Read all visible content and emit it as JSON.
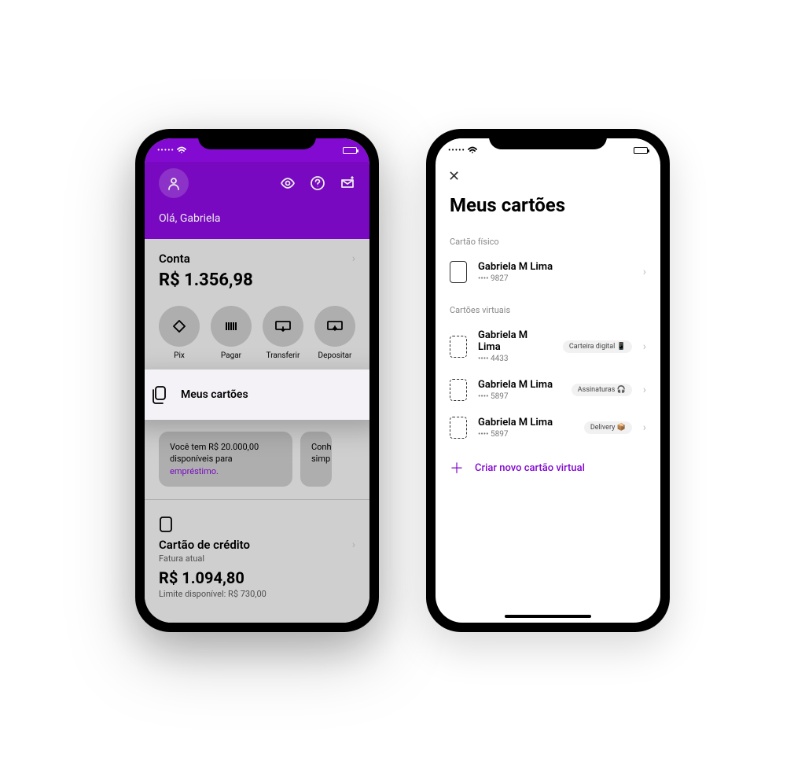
{
  "colors": {
    "brand": "#820ad1"
  },
  "left_phone": {
    "greeting": "Olá, Gabriela",
    "account": {
      "label": "Conta",
      "balance": "R$ 1.356,98"
    },
    "quick_actions": [
      {
        "id": "pix",
        "label": "Pix"
      },
      {
        "id": "pagar",
        "label": "Pagar"
      },
      {
        "id": "transferir",
        "label": "Transferir"
      },
      {
        "id": "depositar",
        "label": "Depositar"
      }
    ],
    "highlight_card": "Meus cartões",
    "promo_text_a": "Você tem R$ 20.000,00 disponíveis para ",
    "promo_link": "empréstimo.",
    "promo_partial": "Conh",
    "promo_partial2": "simp",
    "credit": {
      "title": "Cartão de crédito",
      "subtitle": "Fatura atual",
      "amount": "R$ 1.094,80",
      "limit": "Limite disponível: R$ 730,00"
    }
  },
  "right_phone": {
    "title": "Meus cartões",
    "physical_label": "Cartão físico",
    "physical_card": {
      "name": "Gabriela M Lima",
      "digits": "•••• 9827"
    },
    "virtual_label": "Cartões virtuais",
    "virtual_cards": [
      {
        "name": "Gabriela M Lima",
        "digits": "•••• 4433",
        "tag": "Carteira digital 📱"
      },
      {
        "name": "Gabriela M Lima",
        "digits": "•••• 5897",
        "tag": "Assinaturas 🎧"
      },
      {
        "name": "Gabriela M Lima",
        "digits": "•••• 5897",
        "tag": "Delivery 📦"
      }
    ],
    "create_label": "Criar novo cartão virtual"
  }
}
